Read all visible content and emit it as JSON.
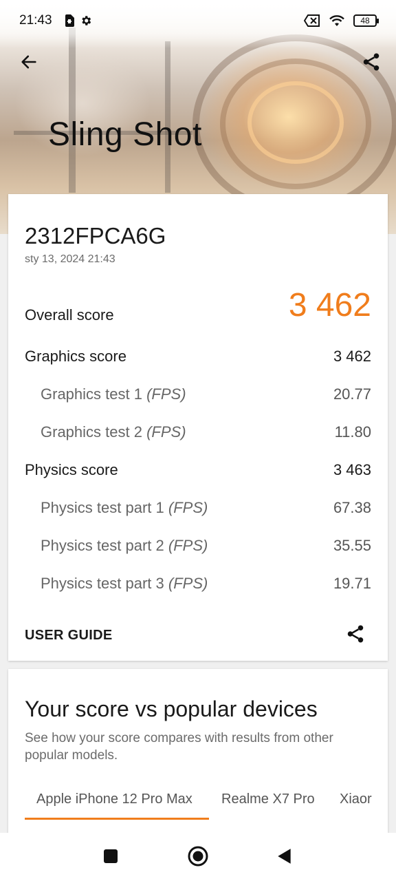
{
  "status_bar": {
    "time": "21:43",
    "battery_level": "48",
    "icons": [
      "sim-card-icon",
      "gear-icon",
      "no-sim-icon",
      "wifi-icon",
      "battery-icon"
    ]
  },
  "header": {
    "title": "Sling Shot",
    "back_icon": "arrow-left-icon",
    "share_icon": "share-icon"
  },
  "result": {
    "device": "2312FPCA6G",
    "date": "sty 13, 2024 21:43",
    "overall_label": "Overall score",
    "overall_value": "3 462",
    "overall_color": "#f07d1c",
    "rows": [
      {
        "label": "Graphics score",
        "unit": "",
        "value": "3 462",
        "level": "main"
      },
      {
        "label": "Graphics test 1",
        "unit": "(FPS)",
        "value": "20.77",
        "level": "sub"
      },
      {
        "label": "Graphics test 2",
        "unit": "(FPS)",
        "value": "11.80",
        "level": "sub"
      },
      {
        "label": "Physics score",
        "unit": "",
        "value": "3 463",
        "level": "main"
      },
      {
        "label": "Physics test part 1",
        "unit": "(FPS)",
        "value": "67.38",
        "level": "sub"
      },
      {
        "label": "Physics test part 2",
        "unit": "(FPS)",
        "value": "35.55",
        "level": "sub"
      },
      {
        "label": "Physics test part 3",
        "unit": "(FPS)",
        "value": "19.71",
        "level": "sub"
      }
    ],
    "user_guide_label": "USER GUIDE"
  },
  "compare": {
    "title": "Your score vs popular devices",
    "description": "See how your score compares with results from other popular models.",
    "tabs": [
      {
        "label": "Apple iPhone 12 Pro Max",
        "active": true
      },
      {
        "label": "Realme X7 Pro",
        "active": false
      },
      {
        "label": "Xiaor",
        "active": false
      }
    ]
  },
  "nav": {
    "buttons": [
      "recents-square-icon",
      "home-circle-icon",
      "back-triangle-icon"
    ]
  }
}
